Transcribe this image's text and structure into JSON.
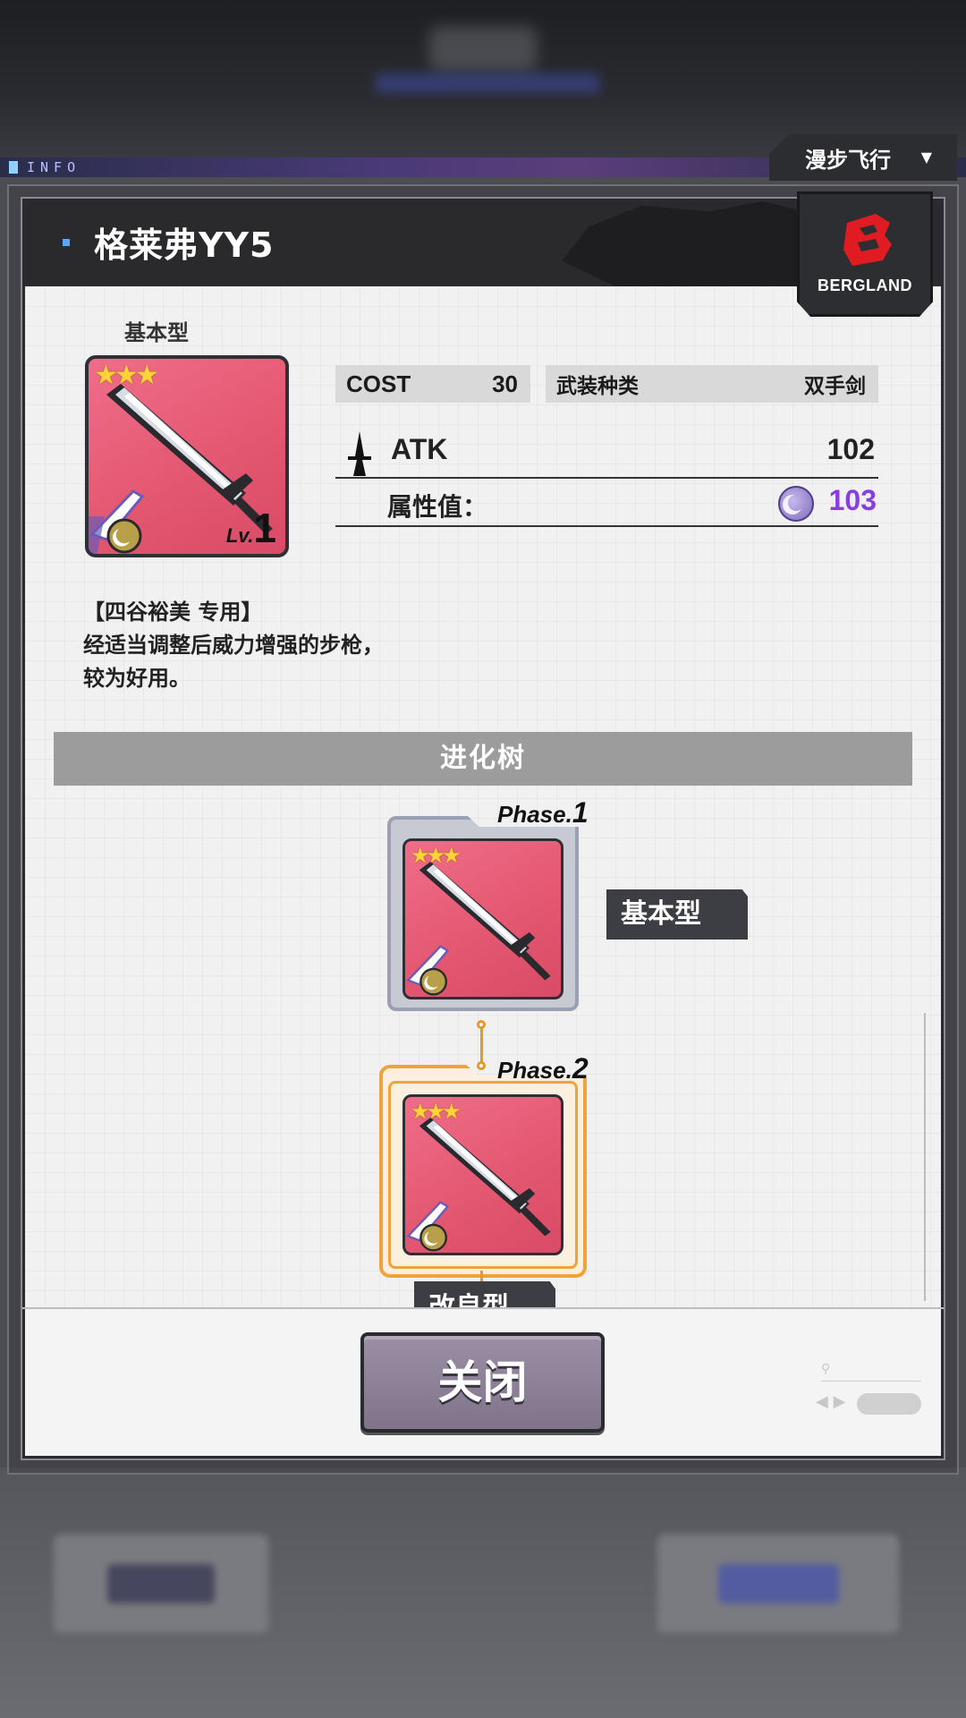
{
  "background": {
    "info_label": "INFO"
  },
  "dropdown": {
    "label": "漫步飞行",
    "caret_icon": "caret-down-icon"
  },
  "modal": {
    "title": "格莱弗YY5",
    "brand": {
      "name": "BERGLAND",
      "logo_icon": "bergland-b-logo",
      "accent": "#e01c22"
    },
    "item": {
      "type_label": "基本型",
      "stars": 3,
      "level_prefix": "Lv.",
      "level": "1",
      "card_color": "#e3566f"
    },
    "stats": {
      "cost_label": "COST",
      "cost_value": "30",
      "weapon_type_label": "武装种类",
      "weapon_type_value": "双手剑",
      "atk_label": "ATK",
      "atk_value": "102",
      "attribute_label": "属性值：",
      "attribute_value": "103",
      "attribute_color": "#8a3de0"
    },
    "description": [
      "【四谷裕美 专用】",
      "经适当调整后威力增强的步枪，",
      "较为好用。"
    ],
    "evolution_tree": {
      "header": "进化树",
      "nodes": [
        {
          "phase_prefix": "Phase.",
          "phase_number": "1",
          "name": "基本型",
          "selected": false
        },
        {
          "phase_prefix": "Phase.",
          "phase_number": "2",
          "name": "改良型",
          "selected": true
        }
      ]
    },
    "close_button": "关闭"
  }
}
